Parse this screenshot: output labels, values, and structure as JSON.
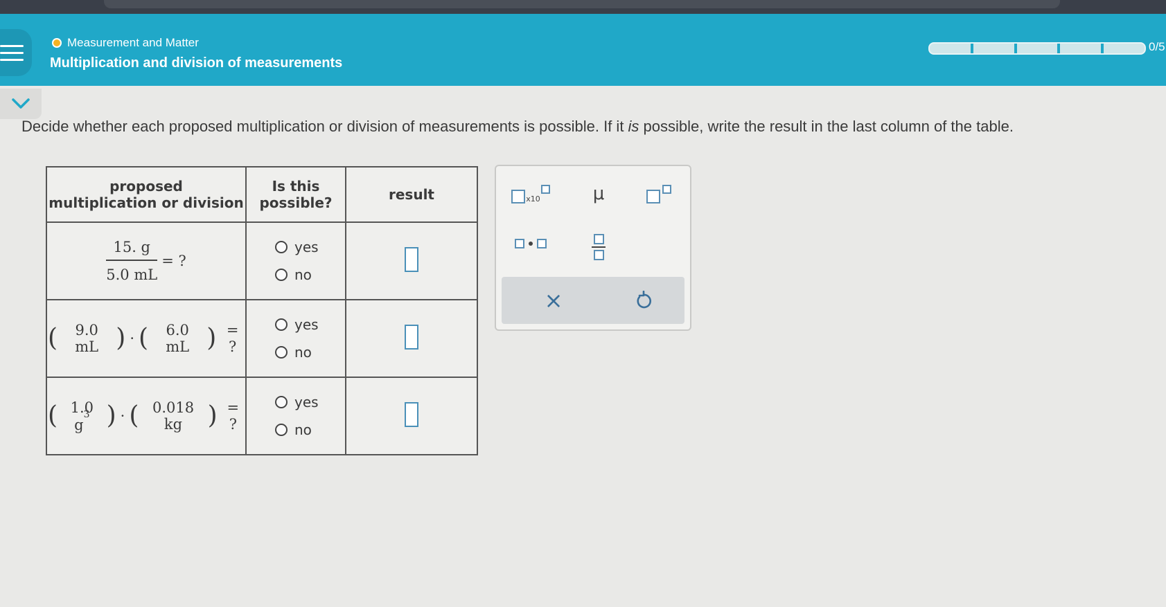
{
  "header": {
    "topic": "Measurement and Matter",
    "lesson_title": "Multiplication and division of measurements",
    "progress_text": "0/5",
    "progress_segments": 5,
    "progress_filled": 0,
    "topic_dot_color": "#f5b324",
    "bar_color": "#20a8c8"
  },
  "instructions": {
    "part1": "Decide whether each proposed multiplication or division of measurements is possible. If it ",
    "emph": "is",
    "part2": " possible, write the result in the last column of the table."
  },
  "table": {
    "headers": {
      "col1_line1": "proposed",
      "col1_line2": "multiplication or division",
      "col2_line1": "Is this",
      "col2_line2": "possible?",
      "col3": "result"
    },
    "rows": [
      {
        "num": "15. g",
        "den": "5.0 mL",
        "eq": "= ?",
        "yes": "yes",
        "no": "no"
      },
      {
        "lparen": "(",
        "a": "9.0 mL",
        "rparen": ")",
        "dot": "·",
        "lparen2": "(",
        "b": "6.0 mL",
        "rparen2": ")",
        "eq": "= ?",
        "yes": "yes",
        "no": "no"
      },
      {
        "lparen": "(",
        "a": "1.0 g",
        "a_exp": "3",
        "rparen": ")",
        "dot": "·",
        "lparen2": "(",
        "b": "0.018 kg",
        "rparen2": ")",
        "eq": "= ?",
        "yes": "yes",
        "no": "no"
      }
    ]
  },
  "toolbox": {
    "x10_label": "x10",
    "mu": "μ",
    "clear": "×",
    "icons": [
      "scientific-notation-icon",
      "mu-icon",
      "superscript-icon",
      "multiply-dot-icon",
      "fraction-icon",
      "clear-icon",
      "undo-icon"
    ]
  }
}
